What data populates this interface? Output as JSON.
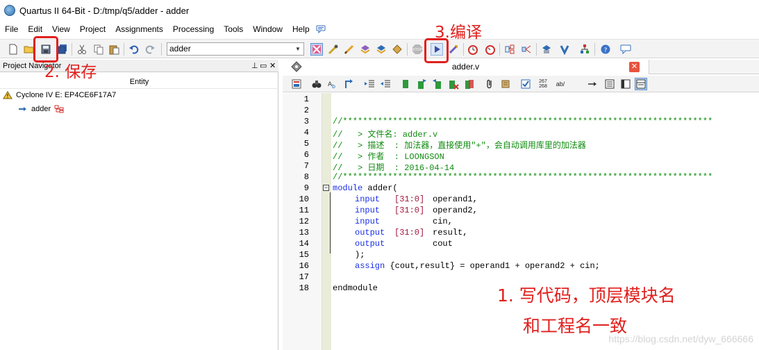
{
  "window": {
    "title": "Quartus II 64-Bit - D:/tmp/q5/adder - adder"
  },
  "menu": {
    "items": [
      "File",
      "Edit",
      "View",
      "Project",
      "Assignments",
      "Processing",
      "Tools",
      "Window",
      "Help"
    ]
  },
  "toolbar": {
    "entity_value": "adder",
    "icons": [
      "new-file-icon",
      "open-folder-icon",
      "save-icon",
      "save-all-icon",
      "cut-icon",
      "copy-icon",
      "paste-icon",
      "undo-icon",
      "redo-icon",
      "stop-icon",
      "start-compilation-icon"
    ]
  },
  "navigator": {
    "title": "Project Navigator",
    "column_header": "Entity",
    "device": "Cyclone IV E: EP4CE6F17A7",
    "top_entity": "adder"
  },
  "editor": {
    "tab_label": "adder.v",
    "toolbar_labels": {
      "line_nums": "267\n268",
      "ab": "ab/"
    },
    "line_numbers": [
      "1",
      "2",
      "3",
      "4",
      "5",
      "6",
      "7",
      "8",
      "9",
      "10",
      "11",
      "12",
      "13",
      "14",
      "15",
      "16",
      "17",
      "18"
    ],
    "code": {
      "l3": "//**************************************************************************",
      "l4": "//   > 文件名: adder.v",
      "l5": "//   > 描述  : 加法器，直接使用\"+\"，会自动调用库里的加法器",
      "l6": "//   > 作者  : LOONGSON",
      "l7": "//   > 日期  : 2016-04-14",
      "l8": "//**************************************************************************",
      "l9_kw": "module",
      "l9_rest": " adder(",
      "port_kw": [
        "input",
        "input",
        "input",
        "output",
        "output"
      ],
      "port_range": [
        "[31:0]",
        "[31:0]",
        "",
        "[31:0]",
        ""
      ],
      "port_name": [
        "operand1,",
        "operand2,",
        "cin,",
        "result,",
        "cout"
      ],
      "l15": ");",
      "l16_kw": "assign",
      "l16_rest": " {cout,result} = operand1 + operand2 + cin;",
      "l18": "endmodule"
    }
  },
  "annotations": {
    "step1_line1": "1. 写代码，顶层模块名",
    "step1_line2": "和工程名一致",
    "step2": "2. 保存",
    "step3": "3.编译",
    "color": "#e0201e"
  },
  "watermark": "https://blog.csdn.net/dyw_666666"
}
